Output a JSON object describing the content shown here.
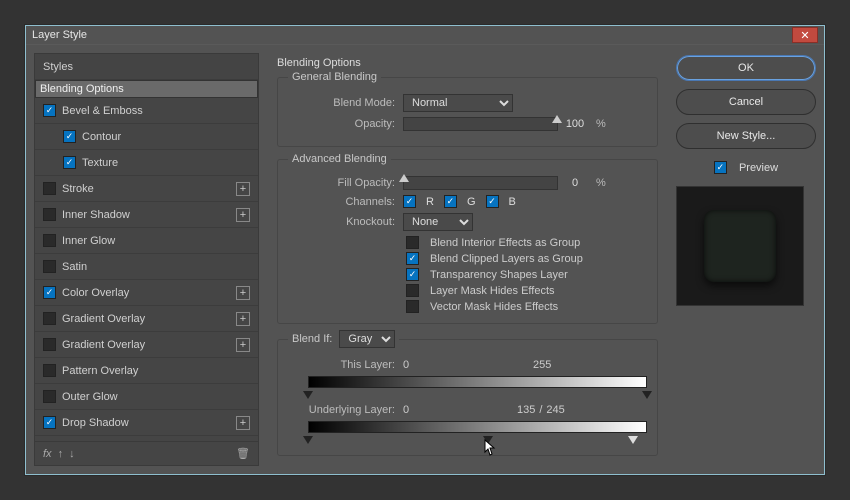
{
  "title": "Layer Style",
  "left": {
    "header": "Styles",
    "items": [
      {
        "label": "Blending Options",
        "checked": null,
        "plus": false,
        "indent": false,
        "selected": true
      },
      {
        "label": "Bevel & Emboss",
        "checked": true,
        "plus": false,
        "indent": false
      },
      {
        "label": "Contour",
        "checked": true,
        "plus": false,
        "indent": true
      },
      {
        "label": "Texture",
        "checked": true,
        "plus": false,
        "indent": true
      },
      {
        "label": "Stroke",
        "checked": false,
        "plus": true,
        "indent": false
      },
      {
        "label": "Inner Shadow",
        "checked": false,
        "plus": true,
        "indent": false
      },
      {
        "label": "Inner Glow",
        "checked": false,
        "plus": false,
        "indent": false
      },
      {
        "label": "Satin",
        "checked": false,
        "plus": false,
        "indent": false
      },
      {
        "label": "Color Overlay",
        "checked": true,
        "plus": true,
        "indent": false
      },
      {
        "label": "Gradient Overlay",
        "checked": false,
        "plus": true,
        "indent": false
      },
      {
        "label": "Gradient Overlay",
        "checked": false,
        "plus": true,
        "indent": false
      },
      {
        "label": "Pattern Overlay",
        "checked": false,
        "plus": false,
        "indent": false
      },
      {
        "label": "Outer Glow",
        "checked": false,
        "plus": false,
        "indent": false
      },
      {
        "label": "Drop Shadow",
        "checked": true,
        "plus": true,
        "indent": false
      }
    ],
    "fx_label": "fx"
  },
  "mid": {
    "section_title": "Blending Options",
    "general": {
      "legend": "General Blending",
      "blend_mode_label": "Blend Mode:",
      "blend_mode_value": "Normal",
      "opacity_label": "Opacity:",
      "opacity_value": "100",
      "pct": "%"
    },
    "advanced": {
      "legend": "Advanced Blending",
      "fill_opacity_label": "Fill Opacity:",
      "fill_opacity_value": "0",
      "pct": "%",
      "channels_label": "Channels:",
      "channels": {
        "r": "R",
        "g": "G",
        "b": "B"
      },
      "knockout_label": "Knockout:",
      "knockout_value": "None",
      "opts": {
        "interior": "Blend Interior Effects as Group",
        "clipped": "Blend Clipped Layers as Group",
        "transparency": "Transparency Shapes Layer",
        "layermask": "Layer Mask Hides Effects",
        "vectormask": "Vector Mask Hides Effects"
      },
      "checked": {
        "interior": false,
        "clipped": true,
        "transparency": true,
        "layermask": false,
        "vectormask": false
      }
    },
    "blendif": {
      "legend_pre": "Blend If:",
      "channel": "Gray",
      "this_label": "This Layer:",
      "this_lo": "0",
      "this_hi": "255",
      "under_label": "Underlying Layer:",
      "under_lo": "0",
      "under_mid": "135",
      "sep": "/",
      "under_hi": "245"
    }
  },
  "right": {
    "ok": "OK",
    "cancel": "Cancel",
    "newstyle": "New Style...",
    "preview": "Preview"
  }
}
